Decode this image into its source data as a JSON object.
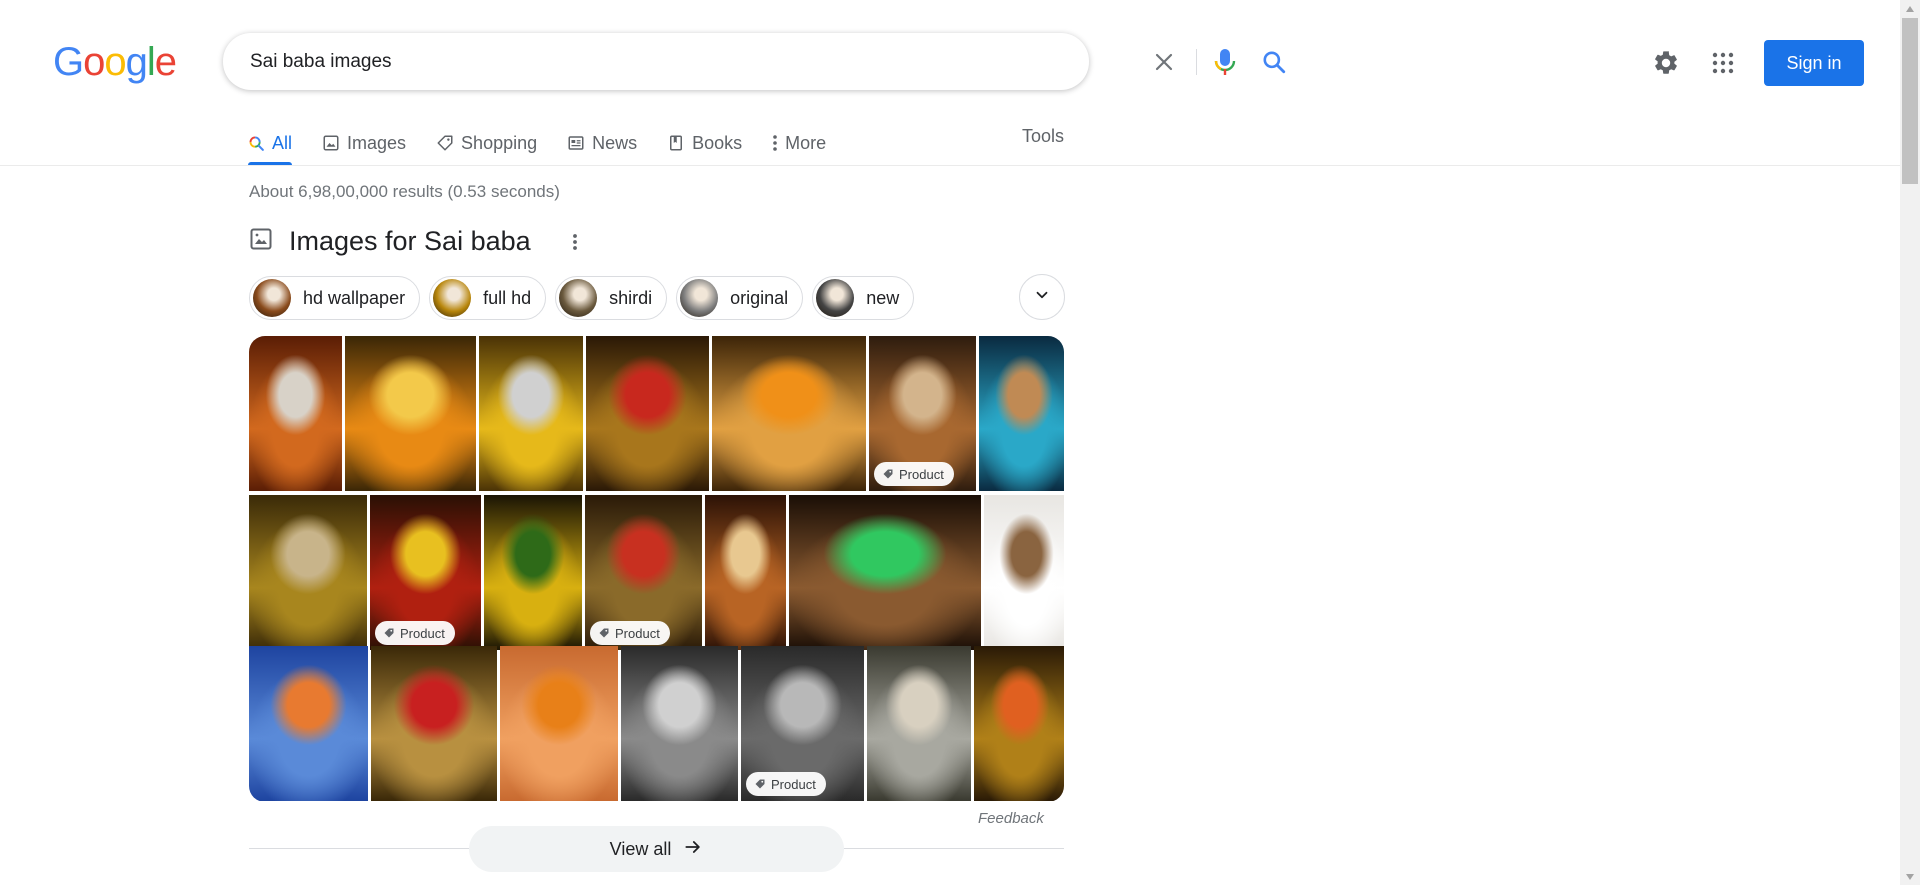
{
  "logo": {
    "letters": [
      "G",
      "o",
      "o",
      "g",
      "l",
      "e"
    ],
    "colors": [
      "#4285f4",
      "#ea4335",
      "#fbbc05",
      "#4285f4",
      "#34a853",
      "#ea4335"
    ]
  },
  "search": {
    "query": "Sai baba images"
  },
  "header": {
    "signin_label": "Sign in"
  },
  "tabs": [
    {
      "label": "All",
      "icon": "search-icon",
      "active": true
    },
    {
      "label": "Images",
      "icon": "image-icon"
    },
    {
      "label": "Shopping",
      "icon": "tag-icon"
    },
    {
      "label": "News",
      "icon": "news-icon"
    },
    {
      "label": "Books",
      "icon": "book-icon"
    },
    {
      "label": "More",
      "icon": "more-vert-icon"
    }
  ],
  "tools_label": "Tools",
  "result_stats": "About 6,98,00,000 results (0.53 seconds)",
  "images_section": {
    "title": "Images for Sai baba",
    "chips": [
      {
        "label": "hd wallpaper"
      },
      {
        "label": "full hd"
      },
      {
        "label": "shirdi"
      },
      {
        "label": "original"
      },
      {
        "label": "new"
      }
    ],
    "product_label": "Product",
    "feedback_label": "Feedback",
    "view_all_label": "View all"
  },
  "colors": {
    "accent": "#1a73e8",
    "chip_thumbs": [
      "#8a4b1c",
      "#b8860b",
      "#6b5a3e",
      "#7d7d7d",
      "#444444"
    ],
    "row1": [
      [
        "#5a1d05",
        "#d2691e",
        "#d8d2c8"
      ],
      [
        "#3a2606",
        "#e88a14",
        "#f3c94a"
      ],
      [
        "#4a3206",
        "#e6b91a",
        "#d0d0d0"
      ],
      [
        "#2a1806",
        "#a8761c",
        "#c8281e"
      ],
      [
        "#3c2408",
        "#e1a042",
        "#f09018"
      ],
      [
        "#2e1c0e",
        "#a86830",
        "#d3b48c"
      ],
      [
        "#0a2a40",
        "#2aa8c8",
        "#c08a54"
      ]
    ],
    "row2": [
      [
        "#3a2a08",
        "#a8861e",
        "#c8b48a"
      ],
      [
        "#2a1004",
        "#b02010",
        "#e8c020"
      ],
      [
        "#1a1404",
        "#d8b010",
        "#2e6a18"
      ],
      [
        "#2a1a08",
        "#8a6a2a",
        "#c83020"
      ],
      [
        "#2c1206",
        "#b86424",
        "#e8c890"
      ],
      [
        "#1a0e06",
        "#8a5a30",
        "#30c860"
      ],
      [
        "#e8e6e2",
        "#ffffff",
        "#8a6440"
      ]
    ],
    "row3": [
      [
        "#1e44a0",
        "#5a8ad8",
        "#e87a30"
      ],
      [
        "#3a2808",
        "#b89040",
        "#c82020"
      ],
      [
        "#c86a30",
        "#f0a060",
        "#e88018"
      ],
      [
        "#2a2a2a",
        "#8a8a8a",
        "#d0d0d0"
      ],
      [
        "#2a2a2a",
        "#6a6a6a",
        "#b8b8b8"
      ],
      [
        "#3a3a30",
        "#a8a8a0",
        "#d8d0c0"
      ],
      [
        "#2a1a06",
        "#b08018",
        "#e06020"
      ]
    ],
    "product_tiles": [
      "1-6",
      "2-2",
      "2-4",
      "3-5"
    ]
  }
}
